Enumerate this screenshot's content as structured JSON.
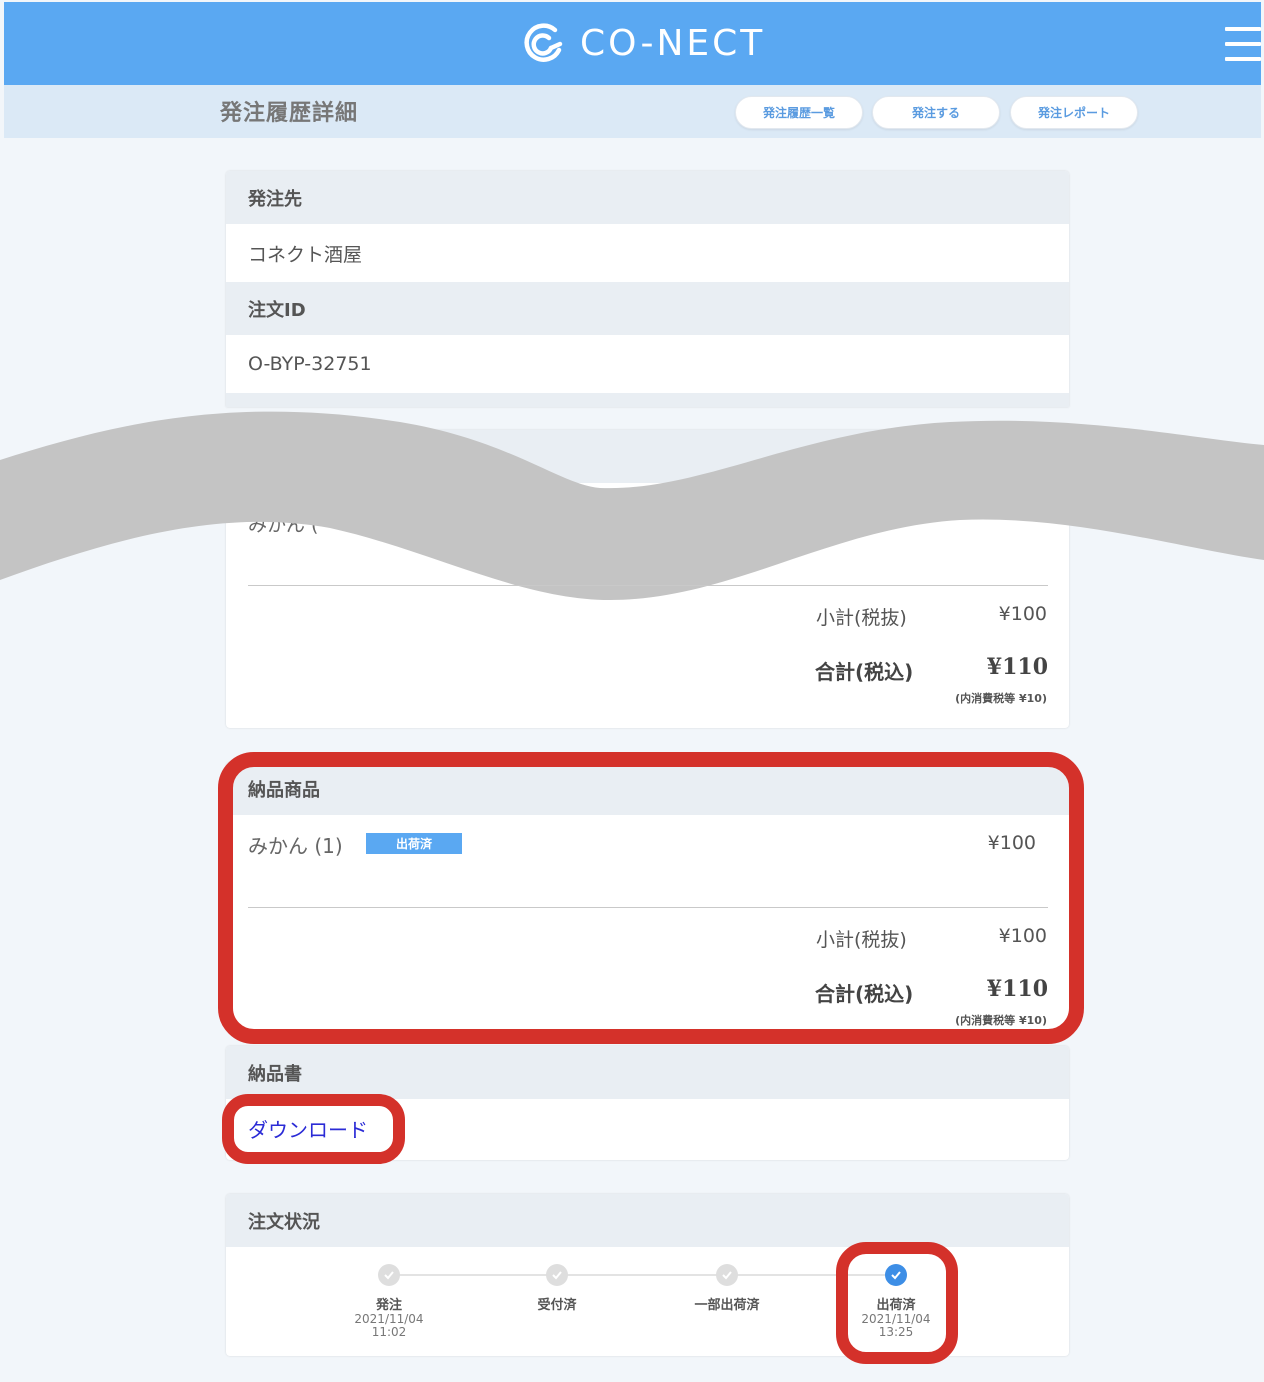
{
  "header": {
    "brand": "CO-NECT",
    "logo_icon": "conect-logo-icon",
    "menu_icon": "hamburger-menu-icon",
    "bar_color": "#5aa8f2"
  },
  "subheader": {
    "title": "発注履歴詳細",
    "buttons": [
      "発注履歴一覧",
      "発注する",
      "発注レポート"
    ]
  },
  "order_info": {
    "supplier_label": "発注先",
    "supplier_value": "コネクト酒屋",
    "order_id_label": "注文ID",
    "order_id_value": "O-BYP-32751"
  },
  "ordered_items_summary": {
    "partial_text": "みかん (",
    "subtotal_label": "小計(税抜)",
    "subtotal_value": "¥100",
    "total_label": "合計(税込)",
    "total_value": "¥110",
    "tax_note": "(内消費税等 ¥10)"
  },
  "delivered_items": {
    "title": "納品商品",
    "item_name": "みかん (1)",
    "status_badge": "出荷済",
    "item_price": "¥100",
    "subtotal_label": "小計(税抜)",
    "subtotal_value": "¥100",
    "total_label": "合計(税込)",
    "total_value": "¥110",
    "tax_note": "(内消費税等 ¥10)"
  },
  "delivery_note": {
    "title": "納品書",
    "download_label": "ダウンロード"
  },
  "order_status": {
    "title": "注文状況",
    "steps": [
      {
        "label": "発注",
        "date": "2021/11/04",
        "time": "11:02",
        "done": false
      },
      {
        "label": "受付済",
        "date": "",
        "time": "",
        "done": false
      },
      {
        "label": "一部出荷済",
        "date": "",
        "time": "",
        "done": false
      },
      {
        "label": "出荷済",
        "date": "2021/11/04",
        "time": "13:25",
        "done": true
      }
    ]
  },
  "annotation_color": "#d4312a"
}
